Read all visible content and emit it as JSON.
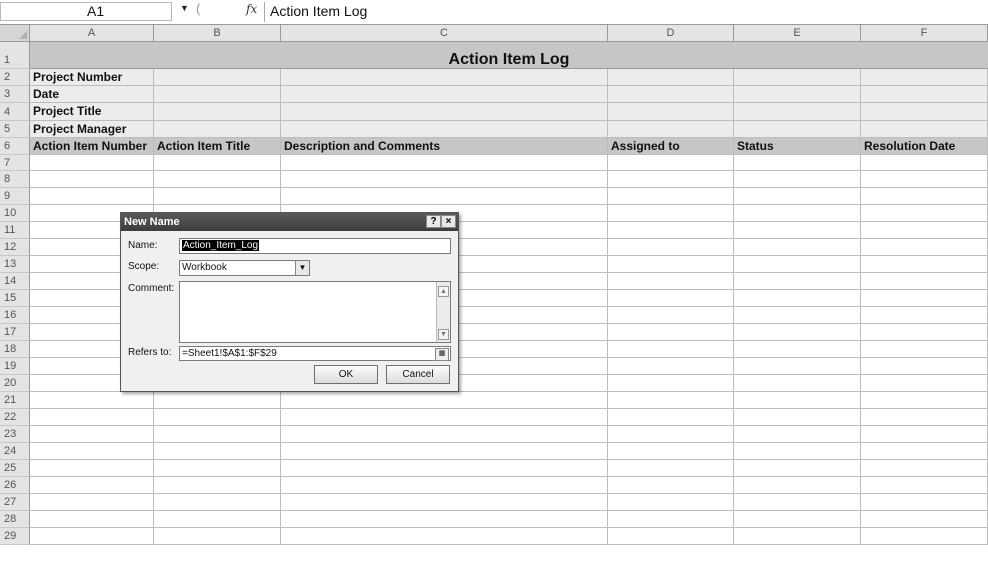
{
  "formula_bar": {
    "name_box": "A1",
    "fx_symbol": "fx",
    "content": "Action Item Log"
  },
  "columns": [
    "A",
    "B",
    "C",
    "D",
    "E",
    "F"
  ],
  "rows": [
    "1",
    "2",
    "3",
    "4",
    "5",
    "6",
    "7",
    "8",
    "9",
    "10",
    "11",
    "12",
    "13",
    "14",
    "15",
    "16",
    "17",
    "18",
    "19",
    "20",
    "21",
    "22",
    "23",
    "24",
    "25",
    "26",
    "27",
    "28",
    "29"
  ],
  "sheet": {
    "title": "Action Item Log",
    "info_labels": [
      "Project Number",
      "Date",
      "Project Title",
      "Project Manager"
    ],
    "headers": [
      "Action Item Number",
      "Action Item Title",
      "Description and Comments",
      "Assigned to",
      "Status",
      "Resolution Date"
    ]
  },
  "dialog": {
    "title": "New Name",
    "help_button": "?",
    "close_button": "×",
    "name_label": "Name:",
    "name_value": "Action_Item_Log",
    "scope_label": "Scope:",
    "scope_value": "Workbook",
    "comment_label": "Comment:",
    "comment_value": "",
    "refers_label": "Refers to:",
    "refers_value": "=Sheet1!$A$1:$F$29",
    "ok_label": "OK",
    "cancel_label": "Cancel"
  }
}
